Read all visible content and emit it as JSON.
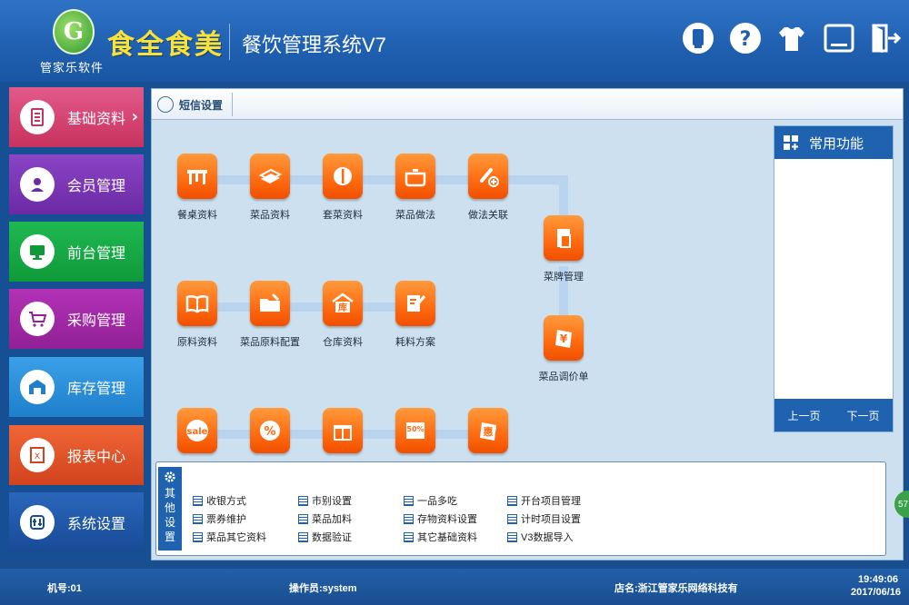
{
  "header": {
    "logo_letter": "G",
    "logo_sub": "管家乐软件",
    "brand": "食全食美",
    "system_title": "餐饮管理系统V7",
    "buttons": [
      {
        "name": "usb-icon"
      },
      {
        "name": "help-icon"
      },
      {
        "name": "skin-icon"
      },
      {
        "name": "minimize-icon"
      },
      {
        "name": "exit-icon"
      }
    ]
  },
  "nav": {
    "items": [
      {
        "label": "基础资料",
        "color": "#d23a6e",
        "icon": "document-icon"
      },
      {
        "label": "会员管理",
        "color": "#7a35b4",
        "icon": "member-icon"
      },
      {
        "label": "前台管理",
        "color": "#16a545",
        "icon": "monitor-icon"
      },
      {
        "label": "采购管理",
        "color": "#a226a6",
        "icon": "cart-icon"
      },
      {
        "label": "库存管理",
        "color": "#2b8fd9",
        "icon": "warehouse-icon"
      },
      {
        "label": "报表中心",
        "color": "#e2512a",
        "icon": "report-icon"
      },
      {
        "label": "系统设置",
        "color": "#1f55a8",
        "icon": "settings-icon"
      }
    ]
  },
  "tab": {
    "label": "短信设置"
  },
  "tiles": {
    "row1": [
      "餐桌资料",
      "菜品资料",
      "套菜资料",
      "菜品做法",
      "做法关联"
    ],
    "side": [
      "菜牌管理",
      "菜品调价单"
    ],
    "row2": [
      "原料资料",
      "菜品原料配置",
      "仓库资料",
      "耗料方案"
    ],
    "row3": [
      "sale",
      "%",
      "",
      "50%",
      "惠"
    ]
  },
  "common": {
    "title": "常用功能",
    "prev": "上一页",
    "next": "下一页"
  },
  "other": {
    "side_label": [
      "其",
      "他",
      "设",
      "置"
    ],
    "cols": [
      [
        "收银方式",
        "票券维护",
        "菜品其它资料"
      ],
      [
        "市别设置",
        "菜品加料",
        "数据验证"
      ],
      [
        "一品多吃",
        "存物资料设置",
        "其它基础资料"
      ],
      [
        "开台项目管理",
        "计时项目设置",
        "V3数据导入"
      ]
    ]
  },
  "status": {
    "machine": "机号:01",
    "operator": "操作员:system",
    "store": "店名:浙江管家乐网络科技有",
    "time": "19:49:06",
    "date": "2017/06/16"
  },
  "side_badge": "57"
}
